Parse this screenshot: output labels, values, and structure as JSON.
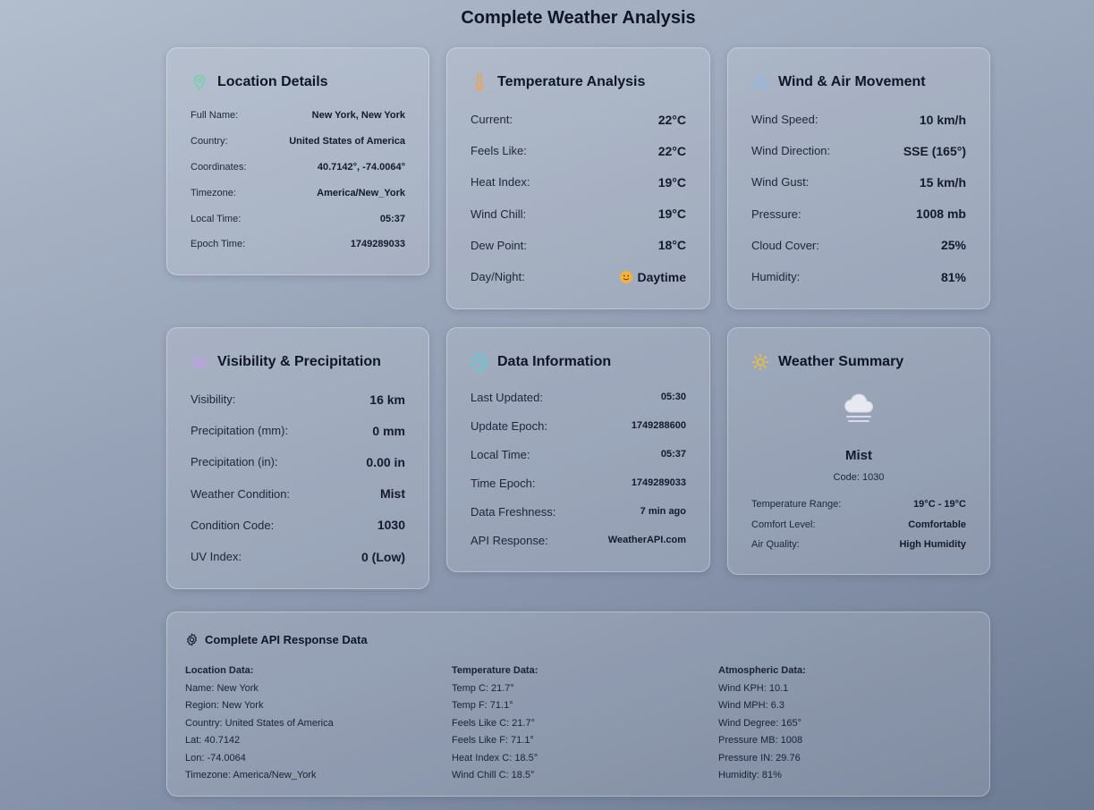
{
  "page_title": "Complete Weather Analysis",
  "location": {
    "title": "Location Details",
    "rows": [
      {
        "k": "Full Name:",
        "v": "New York, New York"
      },
      {
        "k": "Country:",
        "v": "United States of America"
      },
      {
        "k": "Coordinates:",
        "v": "40.7142°, -74.0064°"
      },
      {
        "k": "Timezone:",
        "v": "America/New_York"
      },
      {
        "k": "Local Time:",
        "v": "05:37"
      },
      {
        "k": "Epoch Time:",
        "v": "1749289033"
      }
    ]
  },
  "temperature": {
    "title": "Temperature Analysis",
    "rows": [
      {
        "k": "Current:",
        "v": "22°C"
      },
      {
        "k": "Feels Like:",
        "v": "22°C"
      },
      {
        "k": "Heat Index:",
        "v": "19°C"
      },
      {
        "k": "Wind Chill:",
        "v": "19°C"
      },
      {
        "k": "Dew Point:",
        "v": "18°C"
      },
      {
        "k": "Day/Night:",
        "v": "Daytime"
      }
    ]
  },
  "wind": {
    "title": "Wind & Air Movement",
    "rows": [
      {
        "k": "Wind Speed:",
        "v": "10 km/h"
      },
      {
        "k": "Wind Direction:",
        "v": "SSE (165°)"
      },
      {
        "k": "Wind Gust:",
        "v": "15 km/h"
      },
      {
        "k": "Pressure:",
        "v": "1008 mb"
      },
      {
        "k": "Cloud Cover:",
        "v": "25%"
      },
      {
        "k": "Humidity:",
        "v": "81%"
      }
    ]
  },
  "visibility": {
    "title": "Visibility & Precipitation",
    "rows": [
      {
        "k": "Visibility:",
        "v": "16 km"
      },
      {
        "k": "Precipitation (mm):",
        "v": "0 mm"
      },
      {
        "k": "Precipitation (in):",
        "v": "0.00 in"
      },
      {
        "k": "Weather Condition:",
        "v": "Mist"
      },
      {
        "k": "Condition Code:",
        "v": "1030"
      },
      {
        "k": "UV Index:",
        "v": "0 (Low)"
      }
    ]
  },
  "data_info": {
    "title": "Data Information",
    "rows": [
      {
        "k": "Last Updated:",
        "v": "05:30"
      },
      {
        "k": "Update Epoch:",
        "v": "1749288600"
      },
      {
        "k": "Local Time:",
        "v": "05:37"
      },
      {
        "k": "Time Epoch:",
        "v": "1749289033"
      },
      {
        "k": "Data Freshness:",
        "v": "7 min ago"
      },
      {
        "k": "API Response:",
        "v": "WeatherAPI.com"
      }
    ]
  },
  "summary": {
    "title": "Weather Summary",
    "condition": "Mist",
    "code": "Code: 1030",
    "rows": [
      {
        "k": "Temperature Range:",
        "v": "19°C - 19°C"
      },
      {
        "k": "Comfort Level:",
        "v": "Comfortable"
      },
      {
        "k": "Air Quality:",
        "v": "High Humidity"
      }
    ]
  },
  "api": {
    "title": "Complete API Response Data",
    "columns": [
      {
        "heading": "Location Data:",
        "lines": [
          "Name: New York",
          "Region: New York",
          "Country: United States of America",
          "Lat: 40.7142",
          "Lon: -74.0064",
          "Timezone: America/New_York"
        ]
      },
      {
        "heading": "Temperature Data:",
        "lines": [
          "Temp C: 21.7°",
          "Temp F: 71.1°",
          "Feels Like C: 21.7°",
          "Feels Like F: 71.1°",
          "Heat Index C: 18.5°",
          "Wind Chill C: 18.5°"
        ]
      },
      {
        "heading": "Atmospheric Data:",
        "lines": [
          "Wind KPH: 10.1",
          "Wind MPH: 6.3",
          "Wind Degree: 165°",
          "Pressure MB: 1008",
          "Pressure IN: 29.76",
          "Humidity: 81%"
        ]
      }
    ]
  },
  "colors": {
    "location_icon": "#6fd3a8",
    "temp_icon": "#f0a34a",
    "wind_icon": "#8fb7e8",
    "visibility_icon": "#c49cf0",
    "data_icon": "#4fd1e6",
    "summary_icon": "#f2c230"
  }
}
